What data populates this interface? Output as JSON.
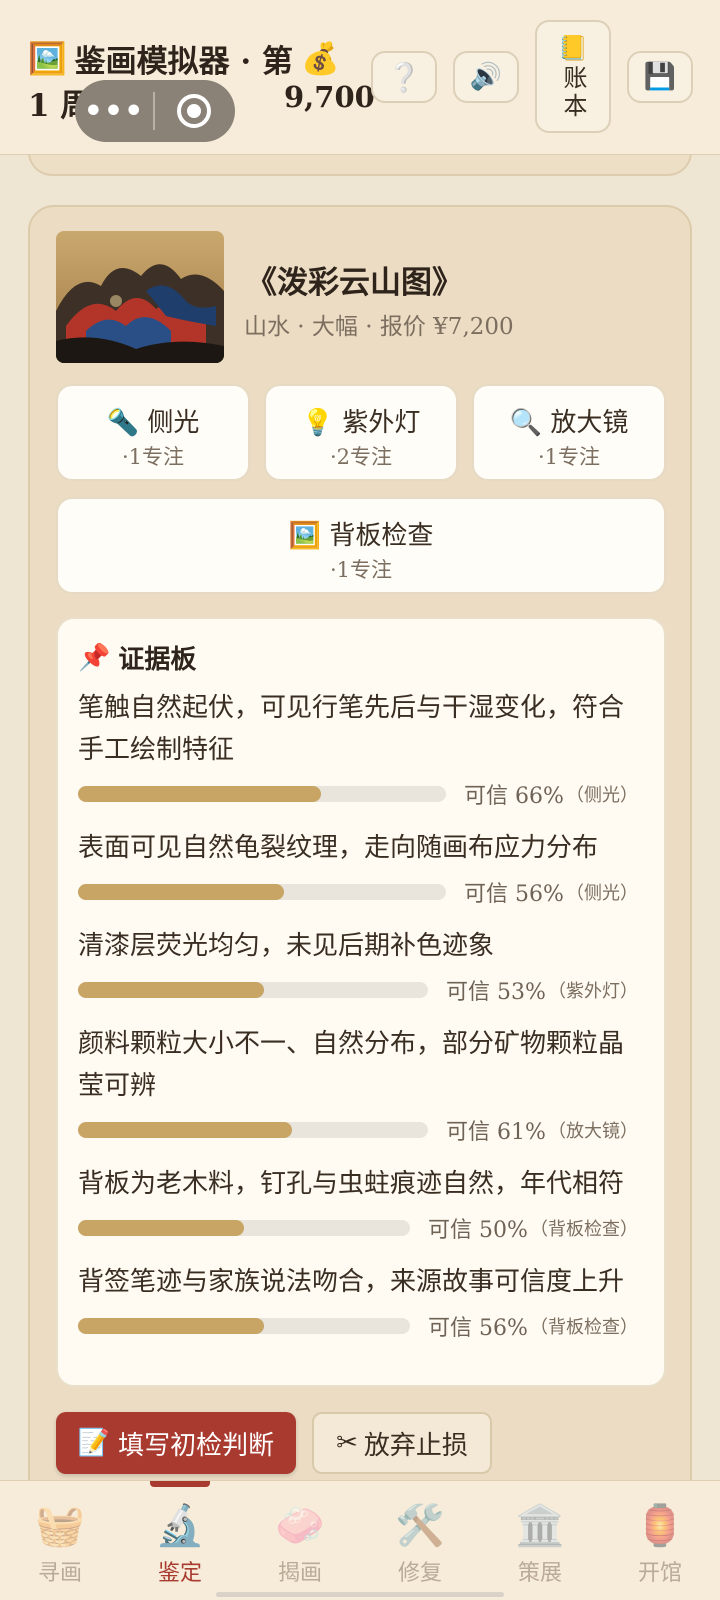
{
  "header": {
    "title_icon": "🖼️",
    "title": "鉴画模拟器 · 第",
    "gold_icon": "💰",
    "week": "1 周",
    "gold": "9,700",
    "capsule_menu": "•••",
    "help_icon": "❔",
    "sound_icon": "🔊",
    "ledger_icon": "📒",
    "ledger_label": "账本",
    "save_icon": "💾"
  },
  "artwork": {
    "title": "《泼彩云山图》",
    "subtitle": "山水 · 大幅 · 报价 ¥7,200"
  },
  "tools": [
    {
      "icon": "🔦",
      "name": "侧光",
      "cost": "·1专注"
    },
    {
      "icon": "💡",
      "name": "紫外灯",
      "cost": "·2专注"
    },
    {
      "icon": "🔍",
      "name": "放大镜",
      "cost": "·1专注"
    },
    {
      "icon": "🖼️",
      "name": "背板检查",
      "cost": "·1专注"
    }
  ],
  "evidence": {
    "icon": "📌",
    "title": "证据板",
    "items": [
      {
        "text": "笔触自然起伏，可见行笔先后与干湿变化，符合手工绘制特征",
        "confidence": 0.66,
        "conf_label": "可信 66%",
        "source": "（侧光）"
      },
      {
        "text": "表面可见自然龟裂纹理，走向随画布应力分布",
        "confidence": 0.56,
        "conf_label": "可信 56%",
        "source": "（侧光）"
      },
      {
        "text": "清漆层荧光均匀，未见后期补色迹象",
        "confidence": 0.53,
        "conf_label": "可信 53%",
        "source": "（紫外灯）"
      },
      {
        "text": "颜料颗粒大小不一、自然分布，部分矿物颗粒晶莹可辨",
        "confidence": 0.61,
        "conf_label": "可信 61%",
        "source": "（放大镜）"
      },
      {
        "text": "背板为老木料，钉孔与虫蛀痕迹自然，年代相符",
        "confidence": 0.5,
        "conf_label": "可信 50%",
        "source": "（背板检查）"
      },
      {
        "text": "背签笔迹与家族说法吻合，来源故事可信度上升",
        "confidence": 0.56,
        "conf_label": "可信 56%",
        "source": "（背板检查）"
      }
    ]
  },
  "actions": {
    "primary_icon": "📝",
    "primary": "填写初检判断",
    "secondary_icon": "✂",
    "secondary": "放弃止损"
  },
  "nav": [
    {
      "icon": "🧺",
      "label": "寻画",
      "active": false
    },
    {
      "icon": "🔬",
      "label": "鉴定",
      "active": true
    },
    {
      "icon": "🧼",
      "label": "揭画",
      "active": false
    },
    {
      "icon": "🛠️",
      "label": "修复",
      "active": false
    },
    {
      "icon": "🏛️",
      "label": "策展",
      "active": false
    },
    {
      "icon": "🏮",
      "label": "开馆",
      "active": false
    }
  ],
  "colors": {
    "accent": "#a93a2f",
    "bar_fill": "#c8a465",
    "background": "#efe5d3"
  }
}
